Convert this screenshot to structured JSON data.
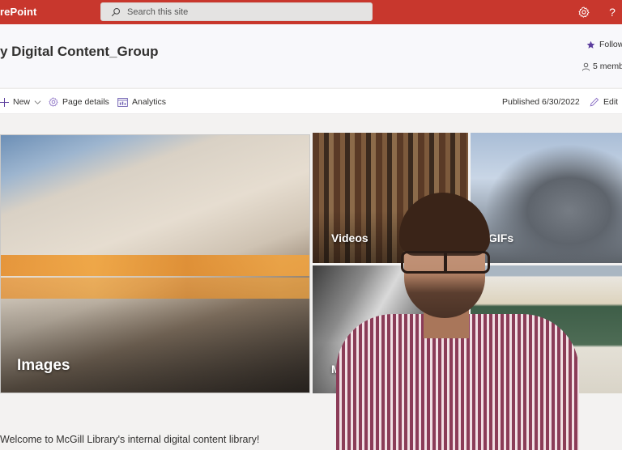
{
  "suite_bar": {
    "app_name": "rePoint",
    "search_placeholder": "Search this site",
    "icons": {
      "search": "search-icon",
      "settings": "gear-icon",
      "help": "help-icon"
    },
    "help_glyph": "?",
    "brand_color": "#c8372d"
  },
  "site_header": {
    "title": "y Digital Content_Group",
    "follow_label": "Follow",
    "members_label": "5 memb",
    "accent_color": "#5c3e9e"
  },
  "command_bar": {
    "new_label": "New",
    "page_details_label": "Page details",
    "analytics_label": "Analytics",
    "published_label": "Published 6/30/2022",
    "edit_label": "Edit"
  },
  "hero": {
    "tiles": [
      {
        "label": "Images"
      },
      {
        "label": "Videos"
      },
      {
        "label": "GIFs"
      },
      {
        "label": "Mo"
      },
      {
        "label": ""
      }
    ]
  },
  "content": {
    "welcome_text": "Welcome to McGill Library's internal digital content library!"
  },
  "overlay": {
    "type": "webcam-video-feed"
  }
}
